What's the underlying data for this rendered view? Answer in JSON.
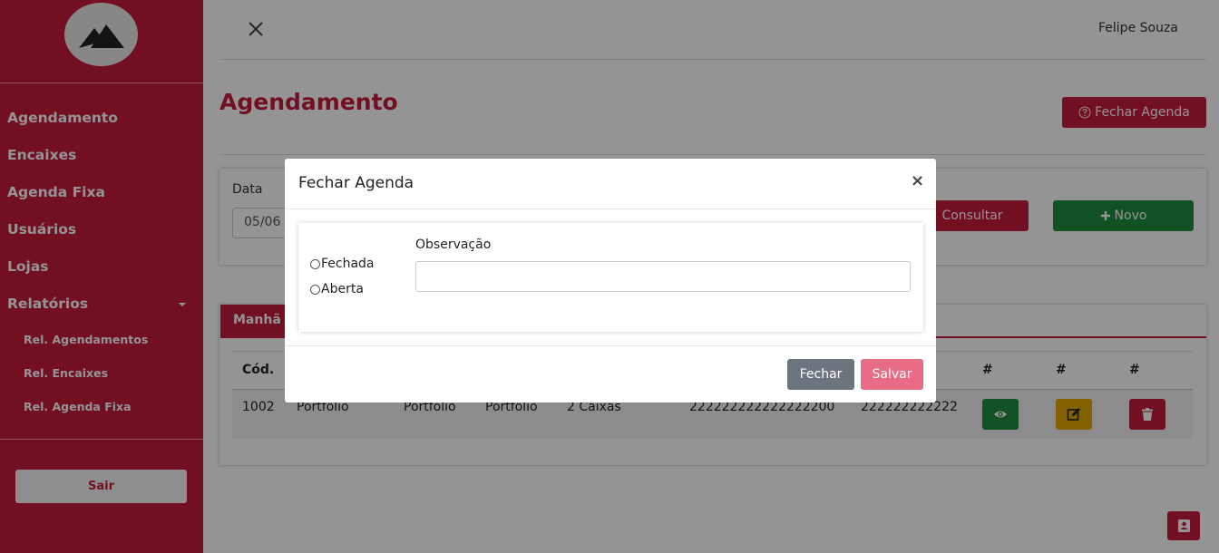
{
  "sidebar": {
    "logo_icon": "mountain-icon",
    "items": [
      {
        "label": "Agendamento"
      },
      {
        "label": "Encaixes"
      },
      {
        "label": "Agenda Fixa"
      },
      {
        "label": "Usuários"
      },
      {
        "label": "Lojas"
      },
      {
        "label": "Relatórios"
      }
    ],
    "sub_items": [
      {
        "label": "Rel. Agendamentos"
      },
      {
        "label": "Rel. Encaixes"
      },
      {
        "label": "Rel. Agenda Fixa"
      }
    ],
    "logout_label": "Sair"
  },
  "header": {
    "user_name": "Felipe Souza"
  },
  "main": {
    "title": "Agendamento",
    "close_agenda_label": "Fechar Agenda",
    "filter": {
      "date_label": "Data",
      "date_value": "05/06",
      "search_label": "Consultar",
      "new_label": "Novo"
    },
    "tab_label": "Manhã",
    "table": {
      "headers": [
        "Cód.",
        "#",
        "#",
        "#"
      ],
      "row": {
        "cod": "1002",
        "c1": "Portfólio",
        "c2": "Portfólio",
        "c3": "Portfólio",
        "c4": "2 Caixas",
        "c5": "222222222222222200",
        "c6": "222222222222"
      }
    }
  },
  "modal": {
    "title": "Fechar Agenda",
    "close_symbol": "×",
    "options": [
      {
        "label": "Fechada"
      },
      {
        "label": "Aberta"
      }
    ],
    "obs_label": "Observação",
    "obs_value": "",
    "cancel_label": "Fechar",
    "save_label": "Salvar"
  },
  "colors": {
    "brand": "#c41a3b",
    "success": "#1e8e3e",
    "warning": "#e0a800",
    "secondary": "#6c757d",
    "save_disabled": "#e86c86"
  }
}
